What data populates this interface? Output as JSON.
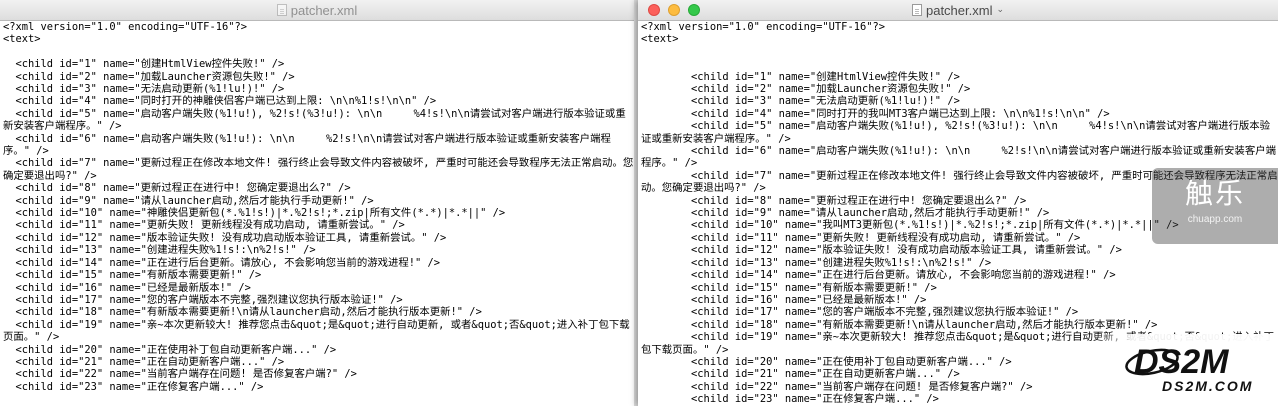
{
  "left_window": {
    "title": "patcher.xml",
    "lines": [
      "<?xml version=\"1.0\" encoding=\"UTF-16\"?>",
      "<text>",
      "",
      "  <child id=\"1\" name=\"创建HtmlView控件失败!\" />",
      "  <child id=\"2\" name=\"加载Launcher资源包失败!\" />",
      "  <child id=\"3\" name=\"无法启动更新(%1!lu!)!\" />",
      "  <child id=\"4\" name=\"同时打开的神雕侠侣客户端已达到上限: \\n\\n%1!s!\\n\\n\" />",
      "  <child id=\"5\" name=\"启动客户端失败(%1!u!), %2!s!(%3!u!): \\n\\n     %4!s!\\n\\n请尝试对客户端进行版本验证或重新安装客户端程序。\" />",
      "  <child id=\"6\" name=\"启动客户端失败(%1!u!): \\n\\n     %2!s!\\n\\n请尝试对客户端进行版本验证或重新安装客户端程序。\" />",
      "  <child id=\"7\" name=\"更新过程正在修改本地文件! 强行终止会导致文件内容被破坏, 严重时可能还会导致程序无法正常启动。您确定要退出吗?\" />",
      "  <child id=\"8\" name=\"更新过程正在进行中! 您确定要退出么?\" />",
      "  <child id=\"9\" name=\"请从launcher启动,然后才能执行手动更新!\" />",
      "  <child id=\"10\" name=\"神雕侠侣更新包(*.%1!s!)|*.%2!s!;*.zip|所有文件(*.*)|*.*||\" />",
      "  <child id=\"11\" name=\"更新失败! 更新线程没有成功启动, 请重新尝试。\" />",
      "  <child id=\"12\" name=\"版本验证失败! 没有成功启动版本验证工具, 请重新尝试。\" />",
      "  <child id=\"13\" name=\"创建进程失败%1!s!:\\n%2!s!\" />",
      "  <child id=\"14\" name=\"正在进行后台更新。请放心, 不会影响您当前的游戏进程!\" />",
      "  <child id=\"15\" name=\"有新版本需要更新!\" />",
      "  <child id=\"16\" name=\"已经是最新版本!\" />",
      "  <child id=\"17\" name=\"您的客户端版本不完整,强烈建议您执行版本验证!\" />",
      "  <child id=\"18\" name=\"有新版本需要更新!\\n请从launcher启动,然后才能执行版本更新!\" />",
      "  <child id=\"19\" name=\"亲~本次更新较大! 推荐您点击&quot;是&quot;进行自动更新, 或者&quot;否&quot;进入补丁包下载页面。\" />",
      "  <child id=\"20\" name=\"正在使用补丁包自动更新客户端...\" />",
      "  <child id=\"21\" name=\"正在自动更新客户端...\" />",
      "  <child id=\"22\" name=\"当前客户端存在问题! 是否修复客户端?\" />",
      "  <child id=\"23\" name=\"正在修复客户端...\" />"
    ]
  },
  "right_window": {
    "title": "patcher.xml",
    "title_chevron": "⌄",
    "lines": [
      "<?xml version=\"1.0\" encoding=\"UTF-16\"?>",
      "<text>",
      "",
      "",
      "        <child id=\"1\" name=\"创建HtmlView控件失败!\" />",
      "        <child id=\"2\" name=\"加载Launcher资源包失败!\" />",
      "        <child id=\"3\" name=\"无法启动更新(%1!lu!)!\" />",
      "        <child id=\"4\" name=\"同时打开的我叫MT3客户端已达到上限: \\n\\n%1!s!\\n\\n\" />",
      "        <child id=\"5\" name=\"启动客户端失败(%1!u!), %2!s!(%3!u!): \\n\\n     %4!s!\\n\\n请尝试对客户端进行版本验证或重新安装客户端程序。\" />",
      "        <child id=\"6\" name=\"启动客户端失败(%1!u!): \\n\\n     %2!s!\\n\\n请尝试对客户端进行版本验证或重新安装客户端程序。\" />",
      "        <child id=\"7\" name=\"更新过程正在修改本地文件! 强行终止会导致文件内容被破坏, 严重时可能还会导致程序无法正常启动。您确定要退出吗?\" />",
      "        <child id=\"8\" name=\"更新过程正在进行中! 您确定要退出么?\" />",
      "        <child id=\"9\" name=\"请从launcher启动,然后才能执行手动更新!\" />",
      "        <child id=\"10\" name=\"我叫MT3更新包(*.%1!s!)|*.%2!s!;*.zip|所有文件(*.*)|*.*||\" />",
      "        <child id=\"11\" name=\"更新失败! 更新线程没有成功启动, 请重新尝试。\" />",
      "        <child id=\"12\" name=\"版本验证失败! 没有成功启动版本验证工具, 请重新尝试。\" />",
      "        <child id=\"13\" name=\"创建进程失败%1!s!:\\n%2!s!\" />",
      "        <child id=\"14\" name=\"正在进行后台更新。请放心, 不会影响您当前的游戏进程!\" />",
      "        <child id=\"15\" name=\"有新版本需要更新!\" />",
      "        <child id=\"16\" name=\"已经是最新版本!\" />",
      "        <child id=\"17\" name=\"您的客户端版本不完整,强烈建议您执行版本验证!\" />",
      "        <child id=\"18\" name=\"有新版本需要更新!\\n请从launcher启动,然后才能执行版本更新!\" />",
      "        <child id=\"19\" name=\"亲~本次更新较大! 推荐您点击&quot;是&quot;进行自动更新, 或者&quot;否&quot;进入补丁包下载页面。\" />",
      "        <child id=\"20\" name=\"正在使用补丁包自动更新客户端...\" />",
      "        <child id=\"21\" name=\"正在自动更新客户端...\" />",
      "        <child id=\"22\" name=\"当前客户端存在问题! 是否修复客户端?\" />",
      "        <child id=\"23\" name=\"正在修复客户端...\" />"
    ]
  },
  "watermarks": {
    "touch": {
      "logo": "触乐",
      "url": "chuapp.com"
    },
    "ds2m": {
      "logo": "DS2M",
      "sub": "DS2M.COM"
    }
  },
  "colors": {
    "close": "#fc605b",
    "minimize": "#fdbc40",
    "zoom": "#34c84a",
    "editor_bg": "#ffffff",
    "text": "#000000"
  }
}
